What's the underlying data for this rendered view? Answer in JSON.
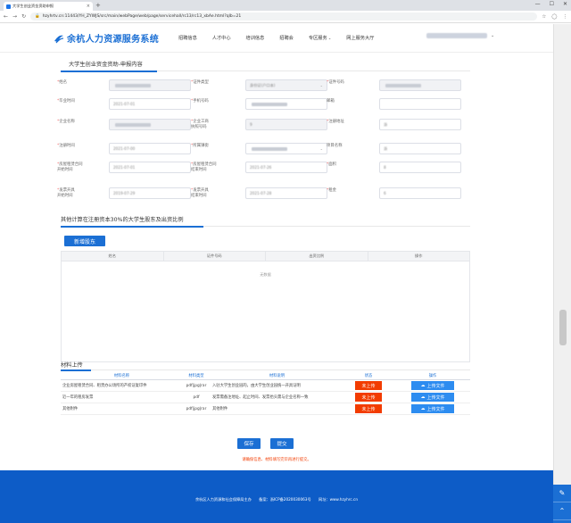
{
  "browser": {
    "tab_title": "大学生创业资金资助申报",
    "new_tab": "+",
    "url": "hzyhrtv.cn:11443/YH_ZYWJS/src/main/webPage/web/page/servicehall/rc13/rc13_xbAe.html?qlb=21",
    "win_min": "—",
    "win_max": "☐",
    "win_close": "✕"
  },
  "site": {
    "logo_text": "余杭人力资源服务系统",
    "menu": [
      "招聘信息",
      "人才中心",
      "培训信息",
      "招聘会",
      "专区服务",
      "网上服务大厅"
    ],
    "user_name": ""
  },
  "form": {
    "section_title": "大学生创业资金资助-申报内容",
    "fields": [
      {
        "label": "姓名",
        "required": true,
        "value": "",
        "disabled": true
      },
      {
        "label": "证件类型",
        "required": true,
        "value": "身份证(户口本)",
        "disabled": true,
        "select": true
      },
      {
        "label": "证件号码",
        "required": true,
        "value": "",
        "disabled": true
      },
      {
        "label": "毕业时间",
        "required": true,
        "value": "2021-07-01"
      },
      {
        "label": "手机号码",
        "required": true,
        "value": "",
        "blurred": true
      },
      {
        "label": "邮箱",
        "required": false,
        "value": ""
      },
      {
        "label": "企业名称",
        "required": true,
        "value": "",
        "disabled": true,
        "blurred": true
      },
      {
        "label": "企业工商\n执照号码",
        "required": true,
        "value": "9",
        "disabled": true
      },
      {
        "label": "注册地址",
        "required": true,
        "value": "浙"
      },
      {
        "label": "注册时间",
        "required": true,
        "value": "2021-07-00"
      },
      {
        "label": "所属镇街",
        "required": true,
        "value": "",
        "select": true,
        "blurred": true
      },
      {
        "label": "项目名称",
        "required": false,
        "value": "浙"
      },
      {
        "label": "房屋租赁合同\n开始时间",
        "required": true,
        "value": "2021-07-01"
      },
      {
        "label": "房屋租赁合同\n结束时间",
        "required": true,
        "value": "2021-07-26"
      },
      {
        "label": "面积",
        "required": true,
        "value": "8"
      },
      {
        "label": "发票开具\n开始时间",
        "required": true,
        "value": "2019-07-29"
      },
      {
        "label": "发票开具\n结束时间",
        "required": true,
        "value": "2021-07-28"
      },
      {
        "label": "租金",
        "required": true,
        "value": "6"
      }
    ]
  },
  "shareholders": {
    "section_title": "其他计算在注册资本30%的大学生股东及出资比例",
    "add_button": "新增股东",
    "columns": [
      "姓名",
      "证件号码",
      "出资比例",
      "操作"
    ],
    "empty_text": "无数据"
  },
  "materials": {
    "section_title": "材料上传",
    "columns": [
      "材料名称",
      "材料类型",
      "材料说明",
      "状态",
      "操作"
    ],
    "rows": [
      {
        "name": "企业房屋租赁合同、租赁办公场所的产权证复印件",
        "type": "pdf|jpg|rar",
        "desc": "入驻大学生创业园的，由大学生创业园统一开具证明",
        "status": "未上传",
        "action": "上传文件"
      },
      {
        "name": "近一年的租房发票",
        "type": "pdf",
        "desc": "发票需备注地址、起止时间、发票抬头需与企业名称一致",
        "status": "未上传",
        "action": "上传文件"
      },
      {
        "name": "其他附件",
        "type": "pdf|jpg|rar",
        "desc": "其他附件",
        "status": "未上传",
        "action": "上传文件"
      }
    ]
  },
  "actions": {
    "save": "保存",
    "submit": "提交",
    "warning": "请确保信息、材料填写完毕再进行提交。"
  },
  "footer": {
    "text": "余杭区人力资源和社会保障局主办　　备案：浙ICP备2020030063号　　网址：www.hzyhrc.cn"
  },
  "colors": {
    "primary": "#1b6fd4",
    "danger": "#f23c00",
    "upload": "#2d8cf0",
    "footer": "#0d5cc7"
  }
}
